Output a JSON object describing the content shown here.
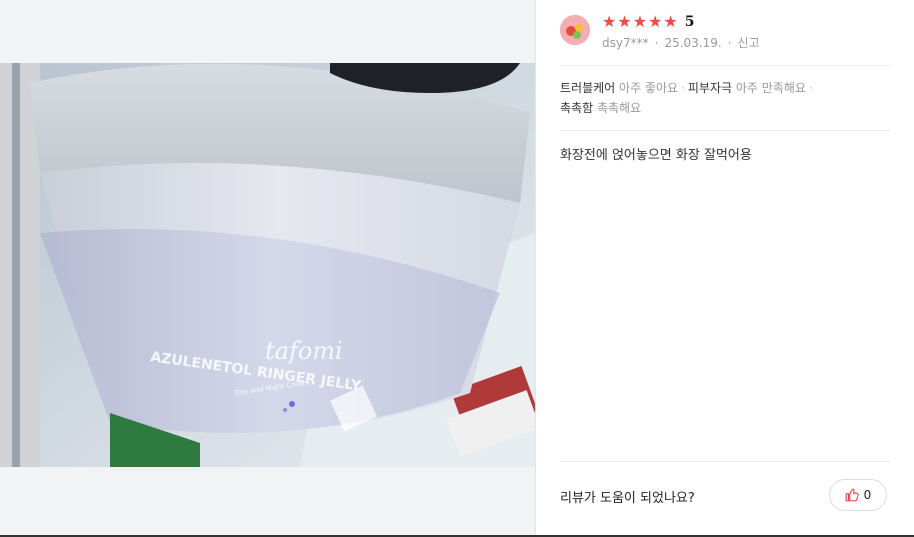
{
  "review": {
    "username": "dsy7***",
    "date": "25.03.19.",
    "report_label": "신고",
    "rating": "5",
    "star_color": "#f04b4b",
    "attributes": [
      {
        "label": "트러블케어",
        "value": "아주 좋아요"
      },
      {
        "label": "피부자극",
        "value": "아주 만족해요"
      },
      {
        "label": "촉촉함",
        "value": "촉촉해요"
      }
    ],
    "text": "화장전에 얹어놓으면 화장 잘먹어용"
  },
  "photo": {
    "brand": "tafomi",
    "product_name": "AZULENETOL RINGER JELLY",
    "subline": "Day and Night Cream"
  },
  "footer": {
    "helpful_question": "리뷰가 도움이 되었나요?",
    "like_count": "0"
  }
}
